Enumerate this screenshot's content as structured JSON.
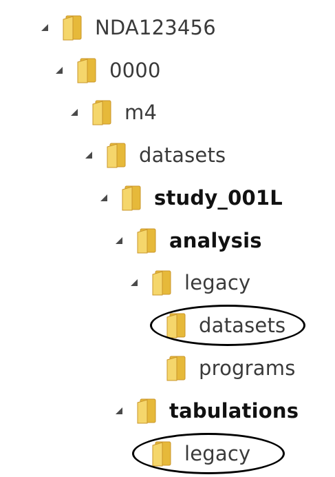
{
  "tree": {
    "nodes": [
      {
        "label": "NDA123456",
        "bold": false,
        "expanded": true,
        "icon": "folder-icon"
      },
      {
        "label": "0000",
        "bold": false,
        "expanded": true,
        "icon": "folder-icon"
      },
      {
        "label": "m4",
        "bold": false,
        "expanded": true,
        "icon": "folder-icon"
      },
      {
        "label": "datasets",
        "bold": false,
        "expanded": true,
        "icon": "folder-icon"
      },
      {
        "label": "study_001L",
        "bold": true,
        "expanded": true,
        "icon": "folder-icon"
      },
      {
        "label": "analysis",
        "bold": true,
        "expanded": true,
        "icon": "folder-icon"
      },
      {
        "label": "legacy",
        "bold": false,
        "expanded": true,
        "icon": "folder-icon"
      },
      {
        "label": "datasets",
        "bold": false,
        "expanded": false,
        "icon": "folder-icon",
        "circled": true
      },
      {
        "label": "programs",
        "bold": false,
        "expanded": false,
        "icon": "folder-icon"
      },
      {
        "label": "tabulations",
        "bold": true,
        "expanded": true,
        "icon": "folder-icon"
      },
      {
        "label": "legacy",
        "bold": false,
        "expanded": false,
        "icon": "folder-icon",
        "circled": true
      }
    ]
  },
  "colors": {
    "folder_front": "#f5d66b",
    "folder_back": "#e6b93a",
    "folder_edge": "#c9952a",
    "expander": "#4a4a4a",
    "circle": "#000000"
  }
}
